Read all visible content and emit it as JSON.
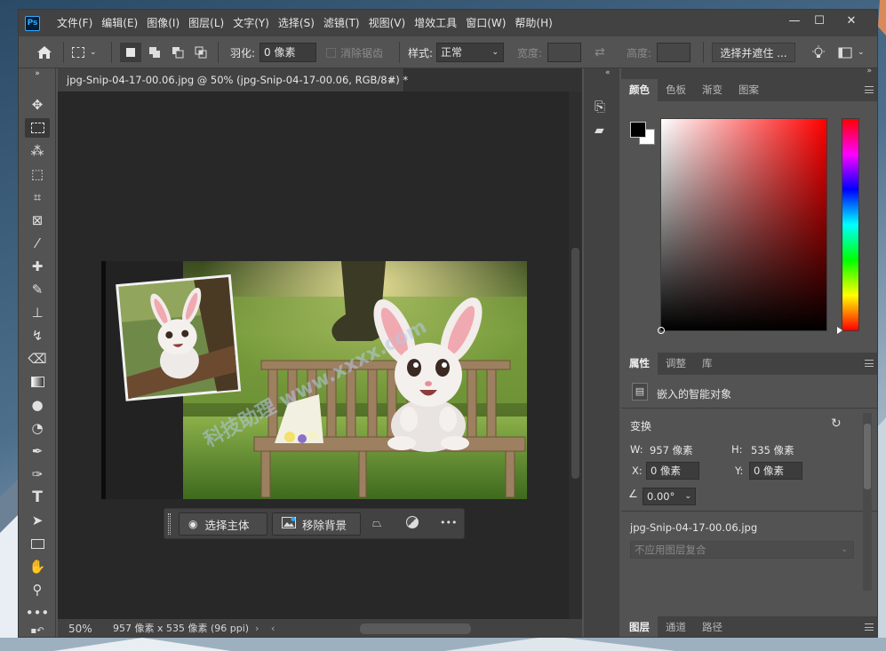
{
  "menubar": {
    "logo": "Ps",
    "items": [
      "文件(F)",
      "编辑(E)",
      "图像(I)",
      "图层(L)",
      "文字(Y)",
      "选择(S)",
      "滤镜(T)",
      "视图(V)",
      "增效工具",
      "窗口(W)",
      "帮助(H)"
    ],
    "minimize": "—",
    "maximize": "☐",
    "close": "✕"
  },
  "options": {
    "feather_label": "羽化:",
    "feather_value": "0 像素",
    "antialias_label": "消除锯齿",
    "style_label": "样式:",
    "style_value": "正常",
    "width_label": "宽度:",
    "height_label": "高度:",
    "select_mask": "选择并遮住 ..."
  },
  "document": {
    "tab_title": "jpg-Snip-04-17-00.06.jpg @ 50% (jpg-Snip-04-17-00.06, RGB/8#) *",
    "tab_close": "×",
    "zoom": "50%",
    "size_info": "957 像素 x 535 像素 (96 ppi)",
    "watermark": "科技助理 www.xxxx.com"
  },
  "contextbar": {
    "select_subject": "选择主体",
    "remove_bg": "移除背景",
    "more": "•••"
  },
  "color_panel": {
    "tabs": [
      "颜色",
      "色板",
      "渐变",
      "图案"
    ],
    "fg": "#000000",
    "bg": "#ffffff"
  },
  "properties": {
    "tabs": [
      "属性",
      "调整",
      "库"
    ],
    "layer_type": "嵌入的智能对象",
    "transform_label": "变换",
    "w_label": "W:",
    "w_value": "957 像素",
    "h_label": "H:",
    "h_value": "535 像素",
    "x_label": "X:",
    "x_value": "0 像素",
    "y_label": "Y:",
    "y_value": "0 像素",
    "angle_value": "0.00°",
    "filename": "jpg-Snip-04-17-00.06.jpg",
    "comp_placeholder": "不应用图层复合"
  },
  "layers_panel": {
    "tabs": [
      "图层",
      "通道",
      "路径"
    ]
  }
}
